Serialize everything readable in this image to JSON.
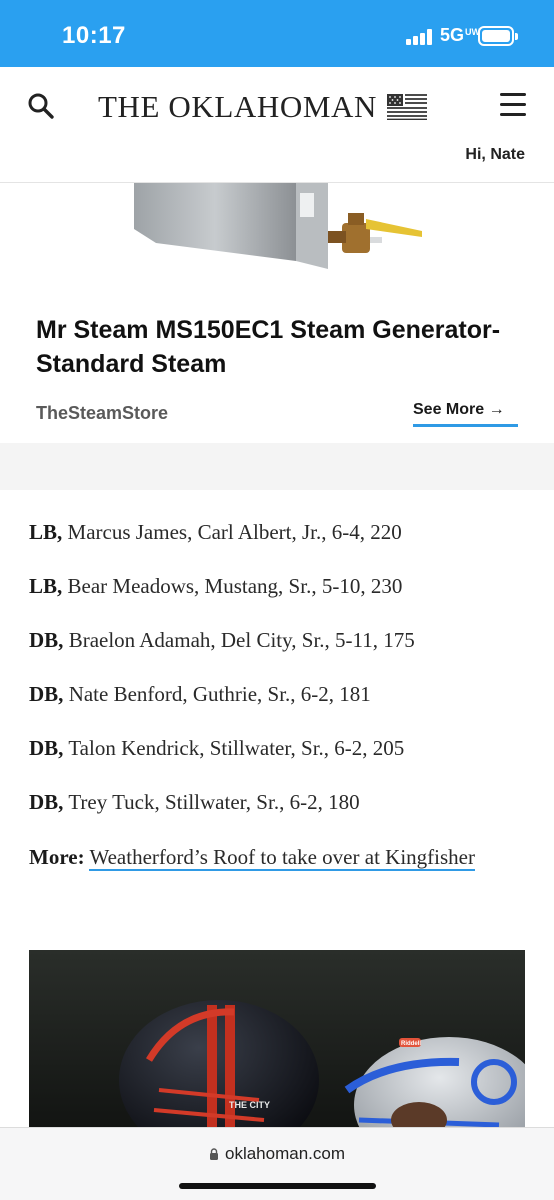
{
  "status_bar": {
    "time": "10:17",
    "network": "5G",
    "network_suffix": "UW",
    "bg_color": "#2aa0f0"
  },
  "header": {
    "brand": "THE OKLAHOMAN",
    "greeting": "Hi, Nate",
    "icons": {
      "search": "search-icon",
      "menu": "hamburger-menu-icon",
      "flag": "us-flag-icon"
    }
  },
  "ad": {
    "title": "Mr Steam MS150EC1 Steam Generator-Standard Steam",
    "source": "TheSteamStore",
    "cta": "See More →",
    "accent": "#2f9ae5"
  },
  "article": {
    "roster": [
      {
        "position": "LB,",
        "details": "Marcus James, Carl Albert, Jr., 6-4, 220"
      },
      {
        "position": "LB,",
        "details": "Bear Meadows, Mustang, Sr., 5-10, 230"
      },
      {
        "position": "DB,",
        "details": "Braelon Adamah, Del City, Sr., 5-11, 175"
      },
      {
        "position": "DB,",
        "details": "Nate Benford, Guthrie, Sr., 6-2, 181"
      },
      {
        "position": "DB,",
        "details": "Talon Kendrick, Stillwater, Sr., 6-2, 205"
      },
      {
        "position": "DB,",
        "details": "Trey Tuck, Stillwater, Sr., 6-2, 180"
      }
    ],
    "more_label": "More:",
    "more_link": "Weatherford’s Roof to take over at Kingfisher",
    "photo_text": {
      "helmet_left": "THE CITY",
      "helmet_right": "Riddell"
    }
  },
  "browser": {
    "url": "oklahoman.com"
  }
}
